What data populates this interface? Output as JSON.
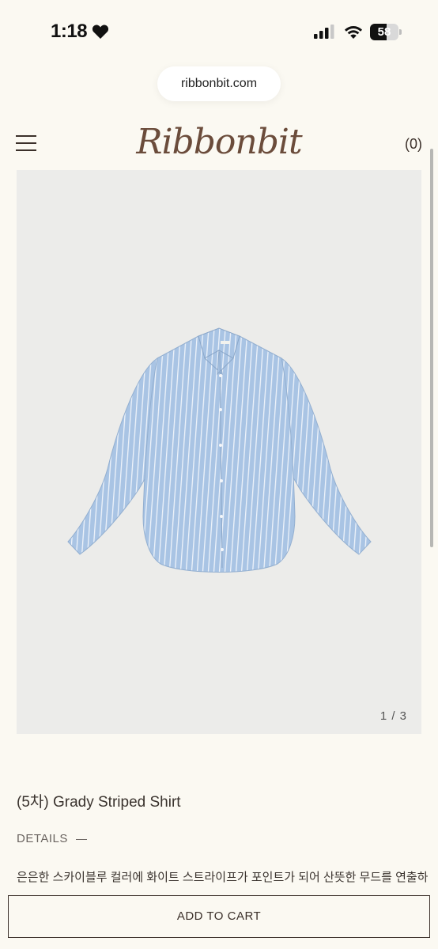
{
  "status": {
    "time": "1:18",
    "battery": "58",
    "battery_level": 0.58
  },
  "browser": {
    "url": "ribbonbit.com"
  },
  "header": {
    "logo": "Ribbonbit",
    "cart_count": "(0)"
  },
  "gallery": {
    "counter": "1 / 3",
    "background_color": "#ececea",
    "shirt_color": "#a9c4e4"
  },
  "product": {
    "title": "(5차) Grady Striped Shirt",
    "details_label": "DETAILS",
    "description": "은은한 스카이블루 컬러에 화이트 스트라이프가 포인트가 되어 산뜻한 무드를 연출하"
  },
  "actions": {
    "add_to_cart": "ADD TO CART"
  }
}
